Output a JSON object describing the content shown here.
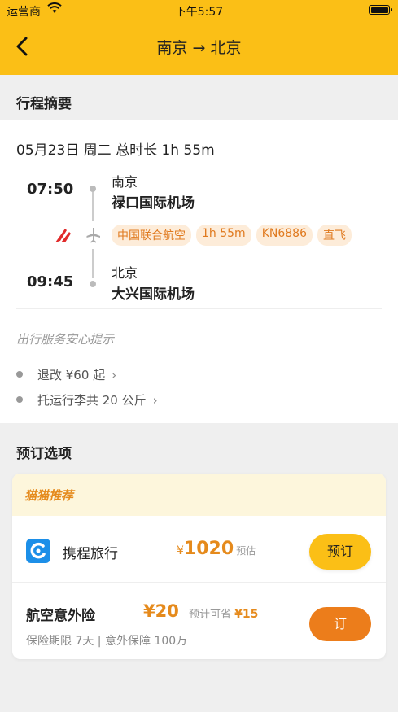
{
  "status_bar": {
    "carrier": "运营商",
    "time": "下午5:57"
  },
  "header": {
    "title": "南京 → 北京"
  },
  "summary": {
    "section_title": "行程摘要",
    "date_line": "05月23日 周二 总时长 1h 55m",
    "departure": {
      "time": "07:50",
      "city": "南京",
      "airport": "禄口国际机场"
    },
    "arrival": {
      "time": "09:45",
      "city": "北京",
      "airport": "大兴国际机场"
    },
    "tags": [
      "中国联合航空",
      "1h 55m",
      "KN6886",
      "直飞"
    ],
    "tips_title": "出行服务安心提示",
    "tips": [
      "退改 ¥60 起",
      "托运行李共 20 公斤"
    ]
  },
  "booking": {
    "section_title": "预订选项",
    "recommend_label": "猫猫推荐",
    "agency": {
      "name": "携程旅行",
      "currency": "¥",
      "price": "1020",
      "price_note": "预估",
      "button": "预订"
    },
    "insurance": {
      "name": "航空意外险",
      "price": "¥20",
      "save_label": "预计可省",
      "save_amount": "¥15",
      "desc": "保险期限 7天 | 意外保障 100万",
      "button": "订"
    }
  },
  "colors": {
    "brand_yellow": "#fbbf16",
    "accent_orange": "#e58a1c",
    "button_orange": "#ec7d1b"
  }
}
